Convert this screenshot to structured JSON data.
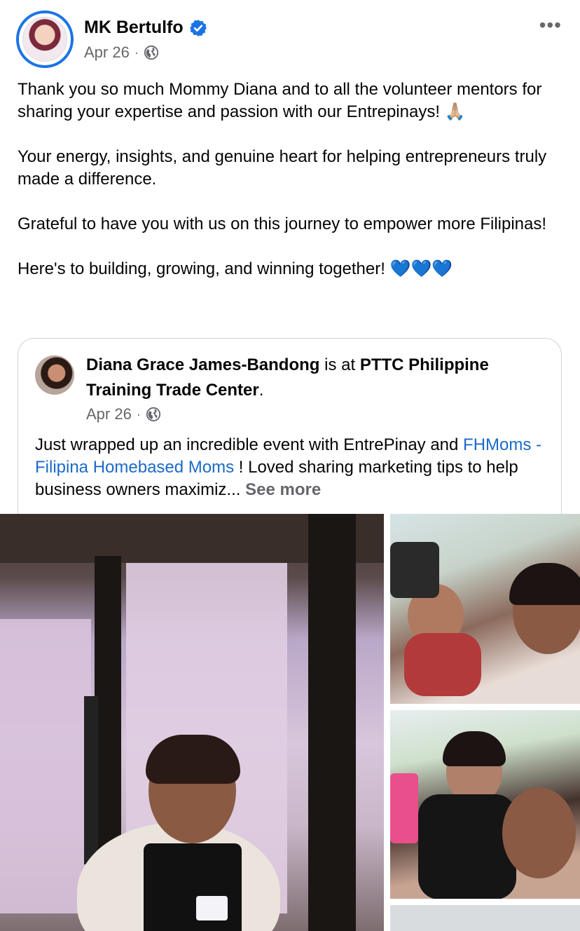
{
  "post": {
    "author": "MK Bertulfo",
    "date": "Apr 26",
    "separator": "·",
    "more_label": "•••",
    "paragraphs": [
      "Thank you so much Mommy Diana and to all the volunteer mentors for sharing your expertise and passion with our Entrepinays! 🙏🏼",
      "Your energy, insights, and genuine heart for helping entrepreneurs truly made a difference.",
      "Grateful to have you with us on this journey to empower more Filipinas!",
      "Here's to building, growing, and winning together! 💙💙💙"
    ]
  },
  "shared": {
    "author": "Diana Grace James-Bandong",
    "connector": " is at ",
    "location": "PTTC Philippine Training Trade Center",
    "period": ".",
    "date": "Apr 26",
    "separator": "·",
    "text_before": "Just wrapped up an incredible event with EntrePinay and ",
    "link_text": "FHMoms - Filipina Homebased Moms",
    "text_after": " ! Loved sharing marketing tips to help business owners maximiz...",
    "see_more": "See more"
  },
  "colors": {
    "verified": "#1b74e4",
    "link": "#1b6ac9",
    "meta": "#65676b"
  },
  "icons": {
    "verified": "verified-badge-icon",
    "audience": "globe-icon",
    "more": "more-options-icon"
  }
}
